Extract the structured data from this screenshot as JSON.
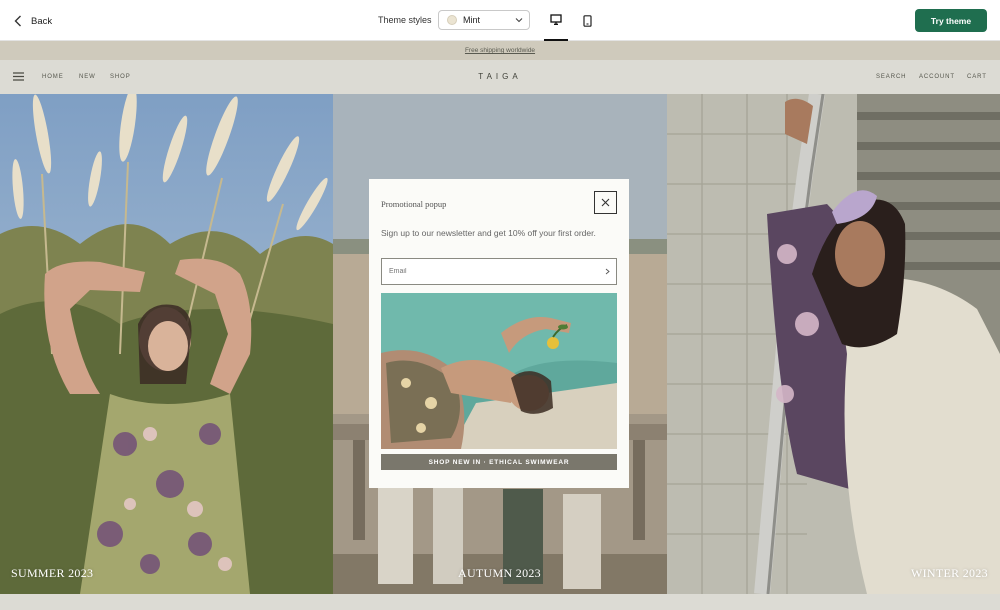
{
  "toolbar": {
    "back_label": "Back",
    "theme_styles_label": "Theme styles",
    "theme_style_selected": "Mint",
    "theme_swatch_color": "#ebe4d2",
    "active_view": "desktop",
    "try_theme_label": "Try theme",
    "accent_color": "#1f6e4f"
  },
  "store": {
    "announcement": "Free shipping worldwide",
    "logo": "TAIGA",
    "nav_left": [
      "HOME",
      "NEW",
      "SHOP"
    ],
    "nav_right": [
      "SEARCH",
      "ACCOUNT",
      "CART"
    ]
  },
  "hero": {
    "columns": [
      {
        "caption": "SUMMER 2023"
      },
      {
        "caption": "AUTUMN 2023"
      },
      {
        "caption": "WINTER 2023"
      }
    ]
  },
  "popup": {
    "title": "Promotional popup",
    "text": "Sign up to our newsletter and get 10% off your first order.",
    "email_placeholder": "Email",
    "cta_label": "SHOP NEW IN · ETHICAL SWIMWEAR"
  },
  "icons": {
    "back": "chevron-left-icon",
    "select": "chevron-down-icon",
    "desktop": "desktop-icon",
    "mobile": "mobile-icon",
    "menu": "hamburger-icon",
    "close": "close-icon",
    "submit": "chevron-right-icon"
  }
}
